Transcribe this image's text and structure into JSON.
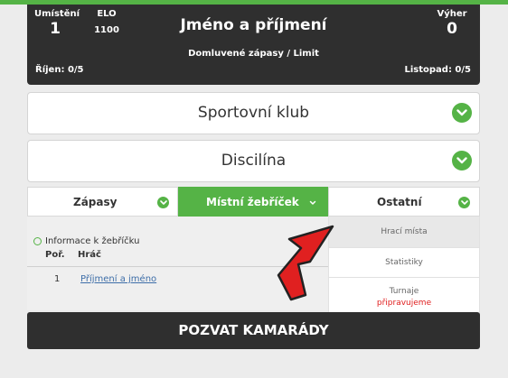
{
  "header": {
    "rank_label": "Umístění",
    "rank_value": "1",
    "elo_label": "ELO",
    "elo_value": "1100",
    "player_name": "Jméno a příjmení",
    "wins_label": "Výher",
    "wins_value": "0",
    "agreed_games": "Domluvené zápasy / Limit",
    "month_left": "Říjen: 0/5",
    "month_right": "Listopad: 0/5"
  },
  "club_dropdown": {
    "label": "Sportovní klub"
  },
  "discipline_dropdown": {
    "label": "Discilína"
  },
  "tabs": [
    {
      "label": "Zápasy",
      "active": false
    },
    {
      "label": "Místní žebříček",
      "active": true
    },
    {
      "label": "Ostatní",
      "active": false
    }
  ],
  "ladder": {
    "info": "Informace k žebříčku",
    "col_rank": "Poř.",
    "col_player": "Hráč",
    "rows": [
      {
        "rank": "1",
        "player": "Příjmení a jméno"
      }
    ]
  },
  "other_menu": {
    "items": [
      {
        "label": "Hrací místa"
      },
      {
        "label": "Statistiky"
      },
      {
        "label": "Turnaje",
        "sublabel": "připravujeme"
      }
    ]
  },
  "invite_button": {
    "label": "POZVAT KAMARÁDY"
  },
  "colors": {
    "accent": "#55b346",
    "dark": "#2f2f2f",
    "highlight_red": "#e02020"
  }
}
